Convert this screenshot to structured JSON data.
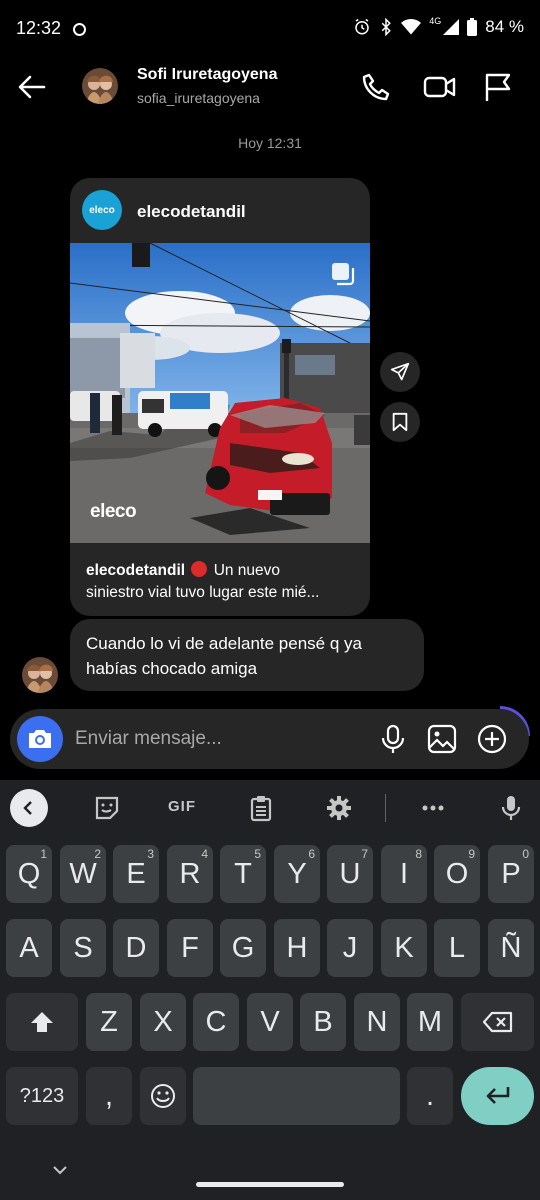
{
  "status_bar": {
    "time": "12:32",
    "network": "4G",
    "battery": "84 %",
    "icons": [
      "alarm-icon",
      "bluetooth-icon",
      "wifi-icon",
      "signal-icon",
      "battery-icon"
    ]
  },
  "header": {
    "name": "Sofi Iruretagoyena",
    "username": "sofia_iruretagoyena",
    "icons": [
      "back-arrow-icon",
      "phone-icon",
      "video-icon",
      "flag-icon"
    ]
  },
  "chat": {
    "timestamp": "Hoy 12:31",
    "shared_post": {
      "account": "elecodetandil",
      "avatar_text": "eleco",
      "watermark": "eleco",
      "caption_user": "elecodetandil",
      "caption_line1": "Un nuevo",
      "caption_line2": "siniestro vial tuvo lugar este mié..."
    },
    "message": {
      "line1": "Cuando lo vi de adelante pensé q ya",
      "line2": "habías chocado amiga"
    }
  },
  "composer": {
    "placeholder": "Enviar mensaje..."
  },
  "keyboard": {
    "toolbar_gif": "GIF",
    "row1": [
      {
        "k": "Q",
        "s": "1"
      },
      {
        "k": "W",
        "s": "2"
      },
      {
        "k": "E",
        "s": "3"
      },
      {
        "k": "R",
        "s": "4"
      },
      {
        "k": "T",
        "s": "5"
      },
      {
        "k": "Y",
        "s": "6"
      },
      {
        "k": "U",
        "s": "7"
      },
      {
        "k": "I",
        "s": "8"
      },
      {
        "k": "O",
        "s": "9"
      },
      {
        "k": "P",
        "s": "0"
      }
    ],
    "row2": [
      "A",
      "S",
      "D",
      "F",
      "G",
      "H",
      "J",
      "K",
      "L",
      "Ñ"
    ],
    "row3": [
      "Z",
      "X",
      "C",
      "V",
      "B",
      "N",
      "M"
    ],
    "symbols_key": "?123",
    "comma_key": ",",
    "period_key": "."
  },
  "colors": {
    "background": "#000000",
    "bubble": "#262626",
    "camera_button": "#3b6ff0",
    "keyboard_bg": "#202124",
    "key": "#3c4043",
    "enter_key": "#7fcfc4"
  }
}
